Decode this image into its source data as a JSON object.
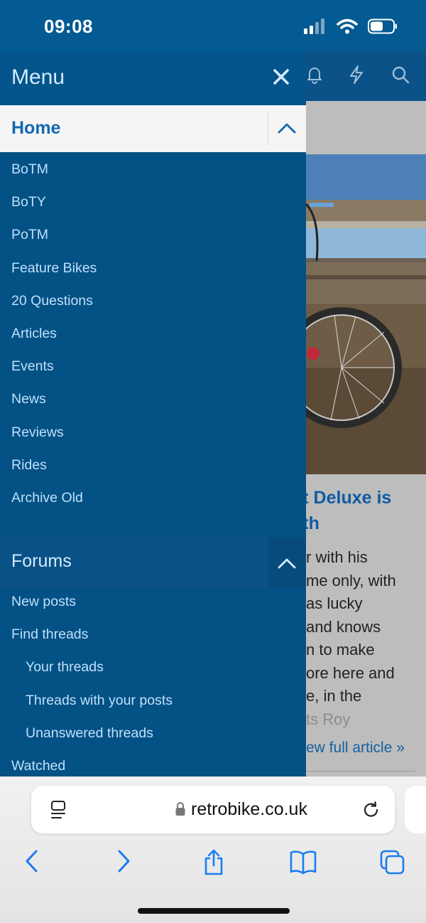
{
  "status_bar": {
    "time": "09:08"
  },
  "menu": {
    "title": "Menu",
    "home": {
      "label": "Home",
      "items": [
        "BoTM",
        "BoTY",
        "PoTM",
        "Feature Bikes",
        "20 Questions",
        "Articles",
        "Events",
        "News",
        "Reviews",
        "Rides",
        "Archive Old"
      ]
    },
    "forums": {
      "label": "Forums",
      "items": [
        {
          "label": "New posts",
          "indent": false
        },
        {
          "label": "Find threads",
          "indent": false
        },
        {
          "label": "Your threads",
          "indent": true
        },
        {
          "label": "Threads with your posts",
          "indent": true
        },
        {
          "label": "Unanswered threads",
          "indent": true
        },
        {
          "label": "Watched",
          "indent": false
        }
      ]
    }
  },
  "page": {
    "header_icons": [
      "bell-icon",
      "lightning-icon",
      "search-icon"
    ],
    "article_title_lines": [
      "nt Deluxe is",
      "nth"
    ],
    "article_text_lines": [
      "r with his",
      "me only, with",
      "as lucky",
      "and knows",
      "n to make",
      "ore here and",
      "e, in the"
    ],
    "article_fade_line": "ts Roy",
    "read_more": "ew full article »"
  },
  "browser": {
    "url": "retrobike.co.uk",
    "nav_icons": [
      "back-icon",
      "forward-icon",
      "share-icon",
      "bookmarks-icon",
      "tabs-icon"
    ]
  },
  "colors": {
    "menu_bg": "#035185",
    "status_bg": "#045a92",
    "menu_link": "#bfe0fb",
    "home_label": "#1268b0",
    "ios_accent": "#1a7cf0"
  }
}
